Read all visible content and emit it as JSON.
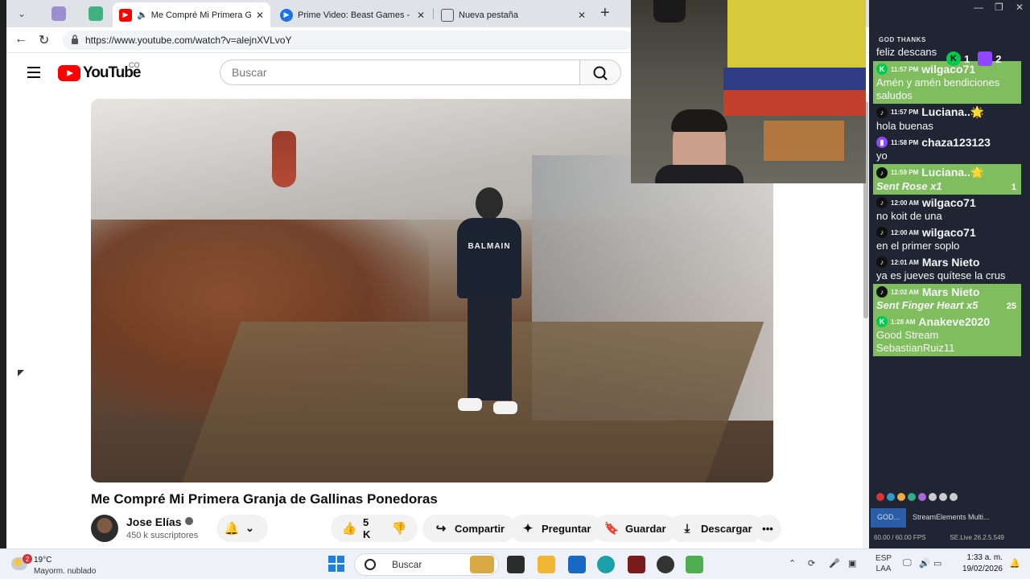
{
  "browser": {
    "tabs": [
      {
        "title": "Me Compré Mi Primera Granja de",
        "active": true
      },
      {
        "title": "Prime Video: Beast Games - Temp",
        "active": false
      },
      {
        "title": "Nueva pestaña",
        "active": false
      }
    ],
    "url": "https://www.youtube.com/watch?v=alejnXVLvoY"
  },
  "youtube": {
    "logo_text": "YouTube",
    "country": "CO",
    "search_placeholder": "Buscar",
    "video_brand_text": "BALMAIN",
    "video_title": "Me Compré Mi Primera Granja de Gallinas Ponedoras",
    "channel_name": "Jose Elías",
    "subscribers": "450 k suscriptores",
    "likes": "5 K",
    "actions": {
      "share": "Compartir",
      "ask": "Preguntar",
      "save": "Guardar",
      "download": "Descargar"
    }
  },
  "obs": {
    "dock_title": "GOD THANKS",
    "top_partial_text": "feliz descans",
    "counter_kick": "1",
    "counter_twitch": "2",
    "messages": [
      {
        "src": "kick",
        "time": "11:57 PM",
        "user": "wilgaco71",
        "text": "Amén y amén bendiciones saludos",
        "highlight": true,
        "italic": false,
        "count": ""
      },
      {
        "src": "tiktok",
        "time": "11:57 PM",
        "user": "Luciana..🌟",
        "text": "hola buenas",
        "highlight": false,
        "italic": false,
        "count": ""
      },
      {
        "src": "twitch",
        "time": "11:58 PM",
        "user": "chaza123123",
        "text": "yo",
        "highlight": false,
        "italic": false,
        "count": ""
      },
      {
        "src": "tiktok",
        "time": "11:59 PM",
        "user": "Luciana..🌟",
        "text": "Sent Rose x1",
        "highlight": true,
        "italic": true,
        "count": "1"
      },
      {
        "src": "tiktok",
        "time": "12:00 AM",
        "user": "wilgaco71",
        "text": "no koit de una",
        "highlight": false,
        "italic": false,
        "count": ""
      },
      {
        "src": "tiktok",
        "time": "12:00 AM",
        "user": "wilgaco71",
        "text": "en el primer soplo",
        "highlight": false,
        "italic": false,
        "count": ""
      },
      {
        "src": "tiktok",
        "time": "12:01 AM",
        "user": "Mars Nieto",
        "text": "ya es jueves quítese la crus",
        "highlight": false,
        "italic": false,
        "count": ""
      },
      {
        "src": "tiktok",
        "time": "12:02 AM",
        "user": "Mars Nieto",
        "text": "Sent Finger Heart x5",
        "highlight": true,
        "italic": true,
        "count": "25"
      },
      {
        "src": "kick",
        "time": "1:28 AM",
        "user": "Anakeve2020",
        "text": "Good Stream SebastianRuiz11",
        "highlight": true,
        "italic": false,
        "count": ""
      }
    ],
    "dock_tabs": [
      "GOD...",
      "StreamElements Multi..."
    ],
    "fps": "60.00 / 60.00 FPS",
    "version": "SE.Live 26.2.5.549"
  },
  "taskbar": {
    "weather_temp": "19°C",
    "weather_desc": "Mayorm. nublado",
    "weather_badge": "2",
    "search": "Buscar",
    "lang1": "ESP",
    "lang2": "LAA",
    "time": "1:33 a. m.",
    "date": "19/02/2026"
  },
  "colors": {
    "yt_red": "#ff0000",
    "chat_highlight": "#7fbd5f",
    "kick_green": "#00c950",
    "twitch_purple": "#9146ff",
    "tiktok": "#111111"
  }
}
